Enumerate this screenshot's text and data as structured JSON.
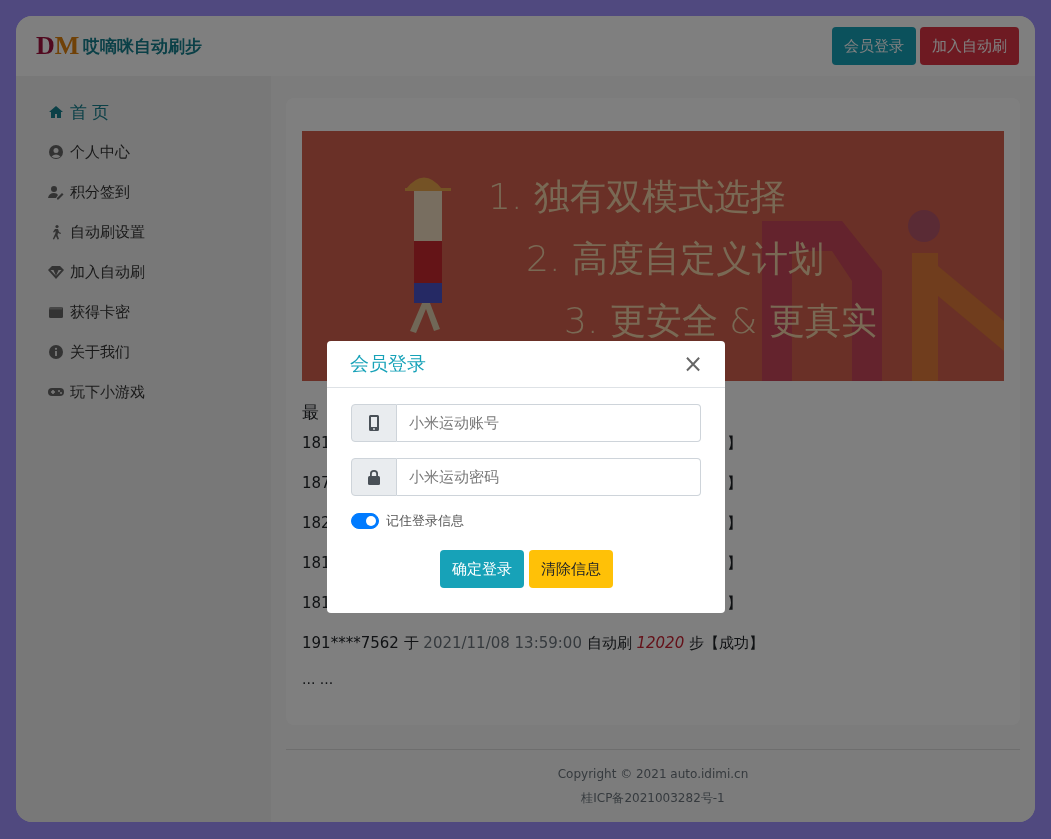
{
  "header": {
    "logo": [
      "D",
      "M"
    ],
    "brand": "哎嘀咪自动刷步",
    "buttons": [
      {
        "label": "会员登录",
        "kind": "info"
      },
      {
        "label": "加入自动刷",
        "kind": "danger"
      }
    ]
  },
  "sidebar": {
    "items": [
      {
        "label": "首 页",
        "selected": true
      },
      {
        "label": "个人中心",
        "selected": false
      },
      {
        "label": "积分签到",
        "selected": false
      },
      {
        "label": "自动刷设置",
        "selected": false
      },
      {
        "label": "加入自动刷",
        "selected": false
      },
      {
        "label": "获得卡密",
        "selected": false
      },
      {
        "label": "关于我们",
        "selected": false
      },
      {
        "label": "玩下小游戏",
        "selected": false
      }
    ]
  },
  "banner": {
    "lines": [
      "1. 独有双模式选择",
      "2. 高度自定义计划",
      "3. 更安全 & 更真实"
    ]
  },
  "records": {
    "heading": "最",
    "rows": [
      {
        "kind": "partial",
        "user": "181",
        "result": "】"
      },
      {
        "kind": "partial",
        "user": "187",
        "result": "】"
      },
      {
        "kind": "partial",
        "user": "182",
        "result": "】"
      },
      {
        "kind": "partial",
        "user": "181",
        "result": "】"
      },
      {
        "kind": "partial",
        "user": "181",
        "result": "】"
      },
      {
        "kind": "full",
        "user": "191****7562",
        "sep": "于",
        "time": "2021/11/08 13:59:00",
        "action": "自动刷",
        "steps": "12020",
        "result": "步【成功】"
      }
    ],
    "more": "... ..."
  },
  "footer": {
    "lines": [
      "Copyright © 2021 auto.idimi.cn",
      "桂ICP备2021003282号-1"
    ]
  },
  "modal": {
    "title": "会员登录",
    "close": "×",
    "fields": [
      {
        "placeholder": "小米运动账号",
        "kind": "phone"
      },
      {
        "placeholder": "小米运动密码",
        "kind": "lock"
      }
    ],
    "remember": {
      "label": "记住登录信息",
      "checked": true
    },
    "buttons": [
      {
        "label": "确定登录",
        "kind": "info"
      },
      {
        "label": "清除信息",
        "kind": "warning"
      }
    ]
  }
}
